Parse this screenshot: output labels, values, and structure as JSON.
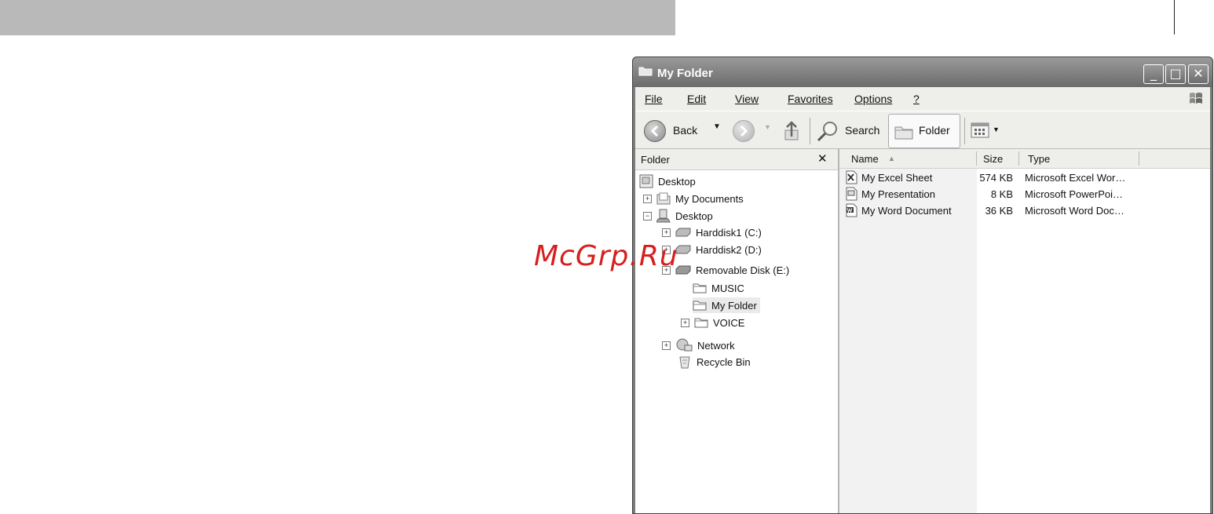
{
  "watermark": "McGrp.Ru",
  "window": {
    "title": "My Folder",
    "controls": {
      "minimize": "_",
      "maximize": "□",
      "close": "✕"
    }
  },
  "menu": {
    "items": [
      "File",
      "Edit",
      "View",
      "Favorites",
      "Options",
      "?"
    ]
  },
  "toolbar": {
    "back": "Back",
    "search": "Search",
    "folder": "Folder"
  },
  "folder_pane": {
    "title": "Folder",
    "close": "✕",
    "tree": [
      {
        "label": "Desktop",
        "icon": "desktop-icon",
        "expander": ""
      },
      {
        "label": "My Documents",
        "icon": "documents-icon",
        "expander": "+"
      },
      {
        "label": "Desktop",
        "icon": "computer-icon",
        "expander": "−"
      },
      {
        "label": "Harddisk1 (C:)",
        "icon": "drive-icon",
        "expander": "+"
      },
      {
        "label": "Harddisk2 (D:)",
        "icon": "drive-icon",
        "expander": "+"
      },
      {
        "label": "Removable Disk (E:)",
        "icon": "removable-drive-icon",
        "expander": "+"
      },
      {
        "label": "MUSIC",
        "icon": "folder-icon",
        "expander": ""
      },
      {
        "label": "My Folder",
        "icon": "folder-icon",
        "expander": "",
        "selected": true
      },
      {
        "label": "VOICE",
        "icon": "folder-icon",
        "expander": "+"
      },
      {
        "label": "Network",
        "icon": "network-icon",
        "expander": "+"
      },
      {
        "label": "Recycle Bin",
        "icon": "recycle-bin-icon",
        "expander": ""
      }
    ]
  },
  "file_list": {
    "columns": [
      "Name",
      "Size",
      "Type"
    ],
    "sort_indicator": "▲",
    "rows": [
      {
        "name": "My Excel Sheet",
        "size": "574 KB",
        "type": "Microsoft Excel Wor…",
        "icon": "excel-file-icon"
      },
      {
        "name": "My Presentation",
        "size": "8 KB",
        "type": "Microsoft PowerPoi…",
        "icon": "powerpoint-file-icon"
      },
      {
        "name": "My Word Document",
        "size": "36 KB",
        "type": "Microsoft Word Doc…",
        "icon": "word-file-icon"
      }
    ]
  }
}
